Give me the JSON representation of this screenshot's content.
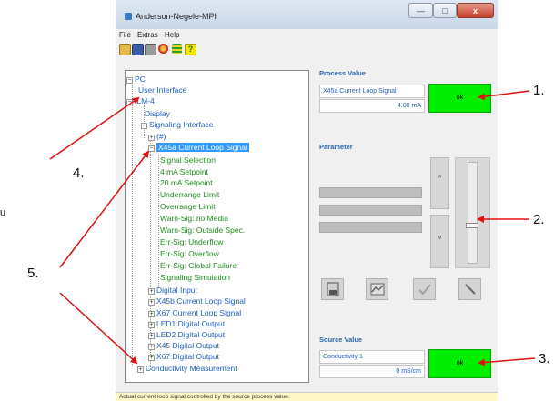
{
  "window": {
    "title": "Anderson-Negele-MPI",
    "minimize": "—",
    "maximize": "□",
    "close": "x"
  },
  "menu": {
    "file": "File",
    "extras": "Extras",
    "help": "Help"
  },
  "toolbar": {
    "icons": [
      "open-icon",
      "save-icon",
      "print-icon",
      "connect-icon",
      "settings-icon",
      "help-icon"
    ],
    "help_label": "?"
  },
  "tree": {
    "pc": "PC",
    "user_interface": "User Interface",
    "ilm": "ILM-4",
    "display": "Display",
    "signaling_interface": "Signaling Interface",
    "hash": "(#)",
    "x45a": "X45a Current Loop Signal",
    "x45a_children": [
      "Signal Selection",
      "4 mA Setpoint",
      "20 mA Setpoint",
      "Underrange Limit",
      "Overrange Limit",
      "Warn-Sig: no Media",
      "Warn-Sig: Outside Spec.",
      "Err-Sig: Underflow",
      "Err-Sig: Overflow",
      "Err-Sig: Global Failure",
      "Signaling Simulation"
    ],
    "siblings": [
      "Digital Input",
      "X45b Current Loop Signal",
      "X67 Current Loop Signal",
      "LED1 Digital Output",
      "LED2 Digital Output",
      "X45 Digital Output",
      "X67 Digital Output"
    ],
    "conductivity": "Conductivity Measurement"
  },
  "process_value": {
    "label": "Process Value",
    "name": "X45a Current Loop Signal",
    "value": "4.00 mA",
    "status": "ok"
  },
  "parameter": {
    "label": "Parameter",
    "up": "^",
    "down": "v",
    "slider_position": 0.62
  },
  "source_value": {
    "label": "Source Value",
    "name": "Conductivity 1",
    "value": "0 mS/cm",
    "status": "ok"
  },
  "status_bar": {
    "text": "Actual current loop signal controlled by the source process value."
  },
  "callouts": {
    "c1": "1.",
    "c2": "2.",
    "c3": "3.",
    "c4": "4.",
    "c5": "5.",
    "side": "u"
  },
  "colors": {
    "ok_green": "#00ee00",
    "selection": "#3399ff",
    "tree_blue": "#1f5fbf",
    "tree_green": "#1f8a1f",
    "arrow_red": "#e01010"
  }
}
